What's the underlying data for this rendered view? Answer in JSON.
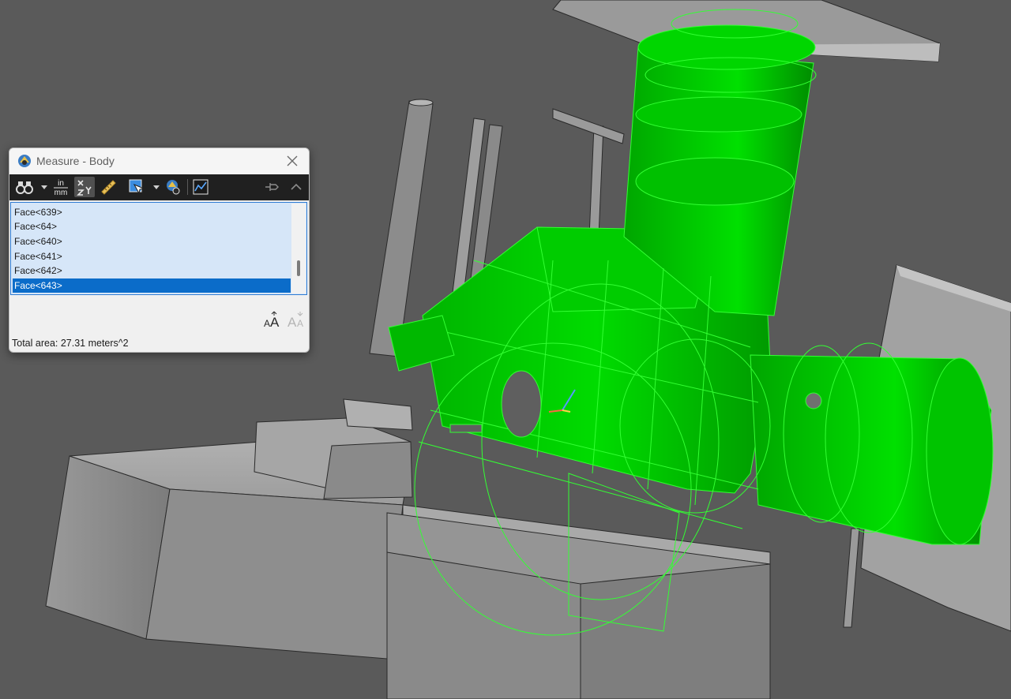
{
  "window": {
    "title": "Measure - Body",
    "close_icon": "close-icon",
    "app_icon": "measure-tool-icon"
  },
  "toolbar": {
    "buttons": [
      {
        "name": "measure-binoculars",
        "icon": "binoculars-icon",
        "has_dropdown": true
      },
      {
        "name": "units",
        "icon": "units-icon",
        "label_top": "in",
        "label_bottom": "mm"
      },
      {
        "name": "xyz-coordinates",
        "icon": "xyz-axis-icon",
        "active": true
      },
      {
        "name": "ruler",
        "icon": "ruler-icon"
      },
      {
        "name": "select-cursor",
        "icon": "cursor-select-icon",
        "has_dropdown": true
      },
      {
        "name": "measure-settings",
        "icon": "measure-settings-icon"
      },
      {
        "name": "graph",
        "icon": "graph-icon"
      },
      {
        "name": "pin",
        "icon": "pin-icon"
      },
      {
        "name": "collapse",
        "icon": "chevron-up-icon"
      }
    ]
  },
  "face_list": {
    "items": [
      "Face<639>",
      "Face<64>",
      "Face<640>",
      "Face<641>",
      "Face<642>",
      "Face<643>"
    ],
    "selected_index": 5
  },
  "font_controls": {
    "increase_icon": "font-size-increase-icon",
    "decrease_icon": "font-size-decrease-icon"
  },
  "status": {
    "total_area": "Total area: 27.31 meters^2"
  },
  "colors": {
    "viewport_bg": "#5a5a5a",
    "highlight_green": "#00d000",
    "wire_green": "#33ff33",
    "list_selected": "#0b6cc9",
    "list_bg": "#d6e6f8"
  }
}
